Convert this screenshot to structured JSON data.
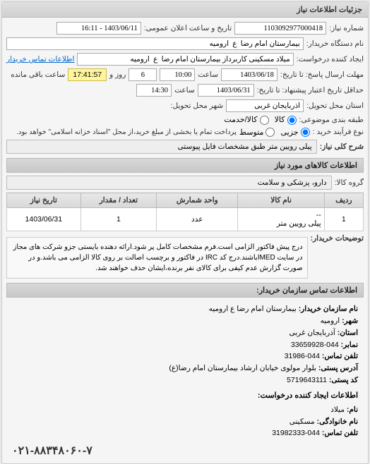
{
  "panel": {
    "title": "جزئیات اطلاعات نیاز"
  },
  "labels": {
    "requestNo": "شماره نیاز:",
    "announceDateTime": "تاریخ و ساعت اعلان عمومی:",
    "buyerOrg": "نام دستگاه خریدار:",
    "requester": "ایجاد کننده درخواست:",
    "buyerContact": "اطلاعات تماس خریدار",
    "deadlineTo": "مهلت ارسال پاسخ: تا تاریخ:",
    "hour": "ساعت",
    "day": "روز و",
    "remaining": "ساعت باقی مانده",
    "validTo": "حداقل تاریخ اعتبار پیشنهاد: تا تاریخ:",
    "deliveryProvince": "استان محل تحویل:",
    "deliveryCity": "شهر محل تحویل:",
    "classification": "طبقه بندی موضوعی:",
    "kala": "کالا",
    "service": "کالا/خدمت",
    "purchaseType": "نوع فرآیند خرید :",
    "partial": "جزیی",
    "medium": "متوسط",
    "paymentNote": "پرداخت تمام یا بخشی از مبلغ خرید،از محل \"اسناد خزانه اسلامی\" خواهد بود.",
    "reqTitle": "شرح کلی نیاز:",
    "goodsInfoTitle": "اطلاعات کالاهای مورد نیاز",
    "goodsGroup": "گروه کالا:",
    "buyerNotes": "توضیحات خریدار:",
    "contactTitle": "اطلاعات تماس سازمان خریدار:",
    "orgName": "نام سازمان خریدار:",
    "city": "شهر:",
    "province": "استان:",
    "fax": "نمابر:",
    "phone": "تلفن تماس:",
    "postalAddr": "آدرس پستی:",
    "postalCode": "کد پستی:",
    "requesterContactTitle": "اطلاعات ایجاد کننده درخواست:",
    "name": "نام:",
    "surname": "نام خانوادگی:",
    "phoneContact": "تلفن تماس:"
  },
  "values": {
    "requestNo": "1103092977000418",
    "announceDateTime": "1403/06/11 - 16:11",
    "buyerOrg": "بیمارستان امام رضا  ع  ارومیه",
    "requester": "میلاد مسکینی کاربرداز بیمارستان امام رضا  ع  ارومیه",
    "deadlineDate": "1403/06/18",
    "deadlineHour": "10:00",
    "remainingDays": "6",
    "remainingTime": "17:41:57",
    "validDate": "1403/06/31",
    "validHour": "14:30",
    "deliveryProvince": "آذربایجان غربی",
    "reqTitle": "پیلی رویین متر طبق مشخصات فایل پیوستی",
    "goodsGroup": "دارو، پزشکی و سلامت",
    "buyerNotes": "درج پیش فاکتور الزامی است.فرم مشخصات کامل پر شود.ارائه دهنده بایستی جزو شرکت های مجاز در سایت IMEDباشند.درج کد IRC در فاکتور و برچسب اصالت بر روی کالا الزامی می باشد.و در صورت گزارش عدم کیفی برای کالای نفر برنده،ایشان حذف خواهند شد.",
    "orgNameVal": "بیمارستان امام رضا ع ارومیه",
    "cityVal": "ارومیه",
    "provinceVal": "آذربایجان غربی",
    "faxVal": "044-33659928",
    "phoneVal": "044-31986",
    "postalAddrVal": "بلوار مولوی خیابان ارشاد بیمارستان امام رضا(ع)",
    "postalCodeVal": "5719643111",
    "reqName": "میلاد",
    "reqSurname": "مسکینی",
    "reqPhone": "044-31982333",
    "hotline": "۰۲۱-۸۸۳۴۸۰۶۰-۷"
  },
  "table": {
    "headers": [
      "ردیف",
      "نام کالا",
      "واحد شمارش",
      "تعداد / مقدار",
      "تاریخ نیاز"
    ],
    "rows": [
      {
        "idx": "1",
        "name": "پیلی رویین متر",
        "unit": "عدد",
        "qty": "1",
        "date": "1403/06/31",
        "sub": "--"
      }
    ]
  }
}
